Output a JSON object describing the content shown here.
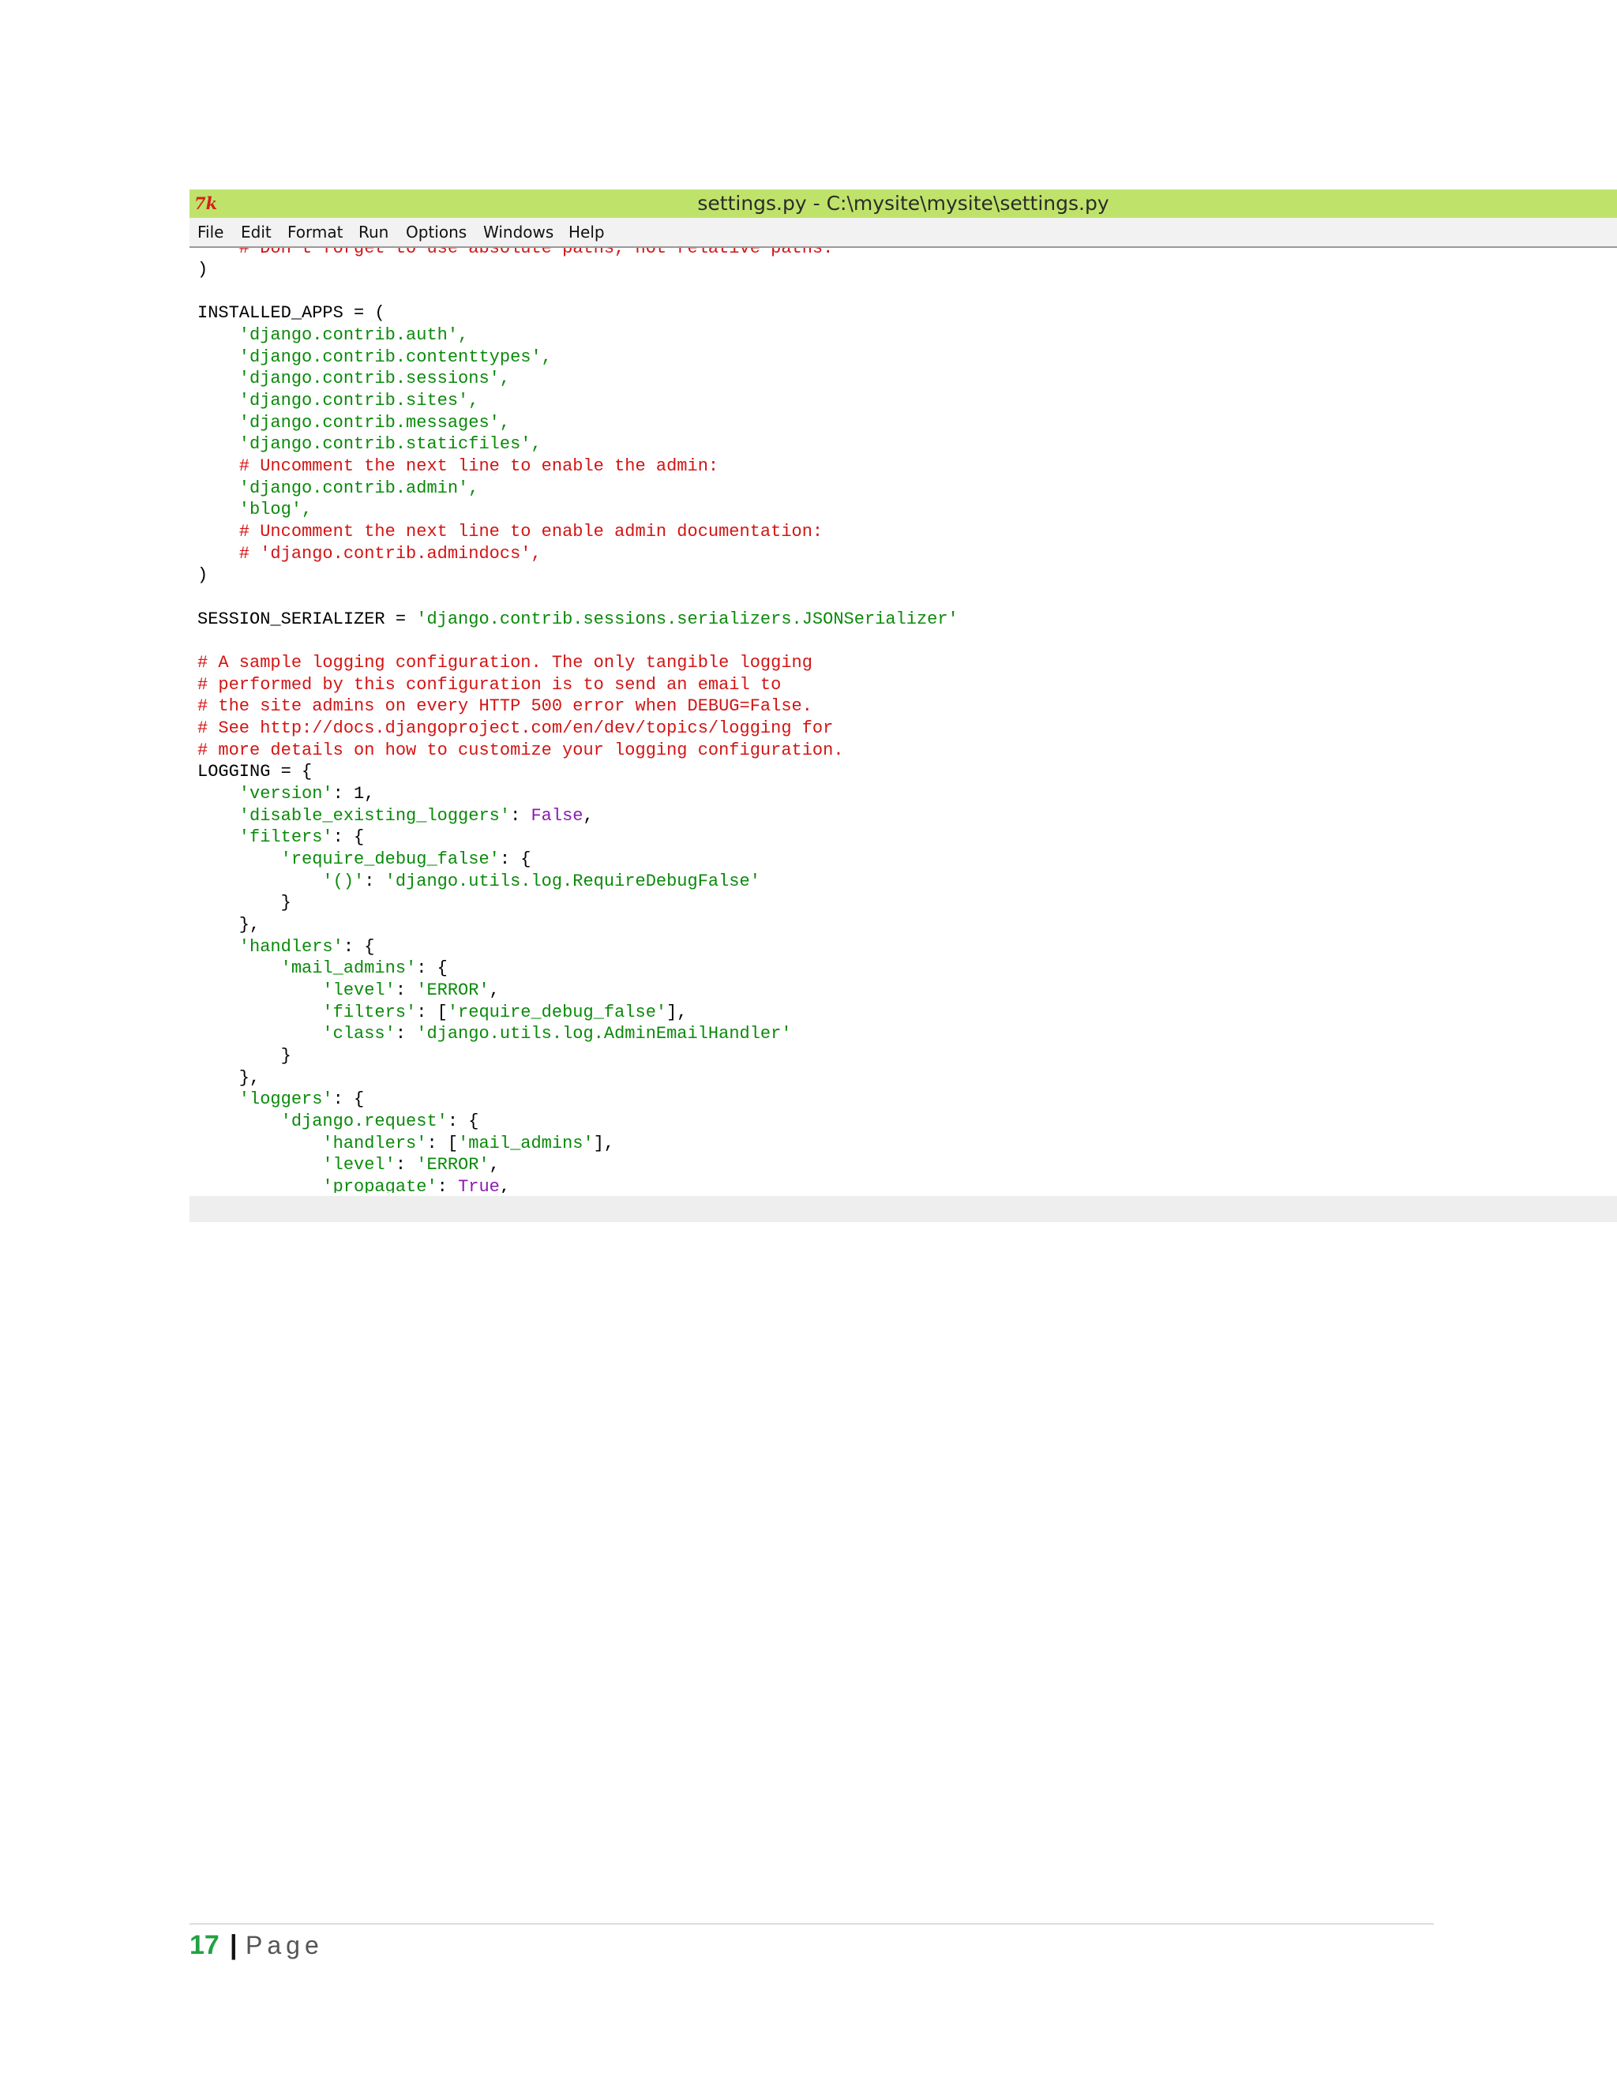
{
  "window": {
    "icon": "tk-icon",
    "icon_text": "7k",
    "title": "settings.py - C:\\mysite\\mysite\\settings.py",
    "titlebar_color": "#bfe36a"
  },
  "menu": {
    "items": [
      "File",
      "Edit",
      "Format",
      "Run",
      "Options",
      "Windows",
      "Help"
    ]
  },
  "code": {
    "syntax_colors": {
      "string": "#0a8a0a",
      "comment": "#d41414",
      "keyword": "#8a1cae",
      "default": "#000000"
    },
    "lines": [
      "    # Don't forget to use absolute paths, not relative paths.",
      ")",
      "",
      "INSTALLED_APPS = (",
      "    'django.contrib.auth',",
      "    'django.contrib.contenttypes',",
      "    'django.contrib.sessions',",
      "    'django.contrib.sites',",
      "    'django.contrib.messages',",
      "    'django.contrib.staticfiles',",
      "    # Uncomment the next line to enable the admin:",
      "    'django.contrib.admin',",
      "    'blog',",
      "    # Uncomment the next line to enable admin documentation:",
      "    # 'django.contrib.admindocs',",
      ")",
      "",
      "SESSION_SERIALIZER = ",
      "'django.contrib.sessions.serializers.JSONSerializer'",
      "",
      "# A sample logging configuration. The only tangible logging",
      "# performed by this configuration is to send an email to",
      "# the site admins on every HTTP 500 error when DEBUG=False.",
      "# See http://docs.djangoproject.com/en/dev/topics/logging for",
      "# more details on how to customize your logging configuration.",
      "LOGGING = {",
      "    'version'",
      ": 1,",
      "    'disable_existing_loggers'",
      ": ",
      "False",
      ",",
      "    'filters'",
      ": {",
      "        'require_debug_false'",
      ": {",
      "            '()'",
      ": ",
      "'django.utils.log.RequireDebugFalse'",
      "        }",
      "    },",
      "    'handlers'",
      ": {",
      "        'mail_admins'",
      ": {",
      "            'level'",
      ": ",
      "'ERROR'",
      ",",
      "            'filters'",
      ": [",
      "'require_debug_false'",
      "],",
      "            'class'",
      ": ",
      "'django.utils.log.AdminEmailHandler'",
      "        }",
      "    },",
      "    'loggers'",
      ": {",
      "        'django.request'",
      ": {",
      "            'handlers'",
      ": [",
      "'mail_admins'",
      "],",
      "            'level'",
      ": ",
      "'ERROR'",
      ",",
      "            'propagate'",
      ": ",
      "True",
      ","
    ]
  },
  "footer": {
    "page_number": "17",
    "separator": "|",
    "page_label": "Page",
    "page_number_color": "#23a241"
  }
}
